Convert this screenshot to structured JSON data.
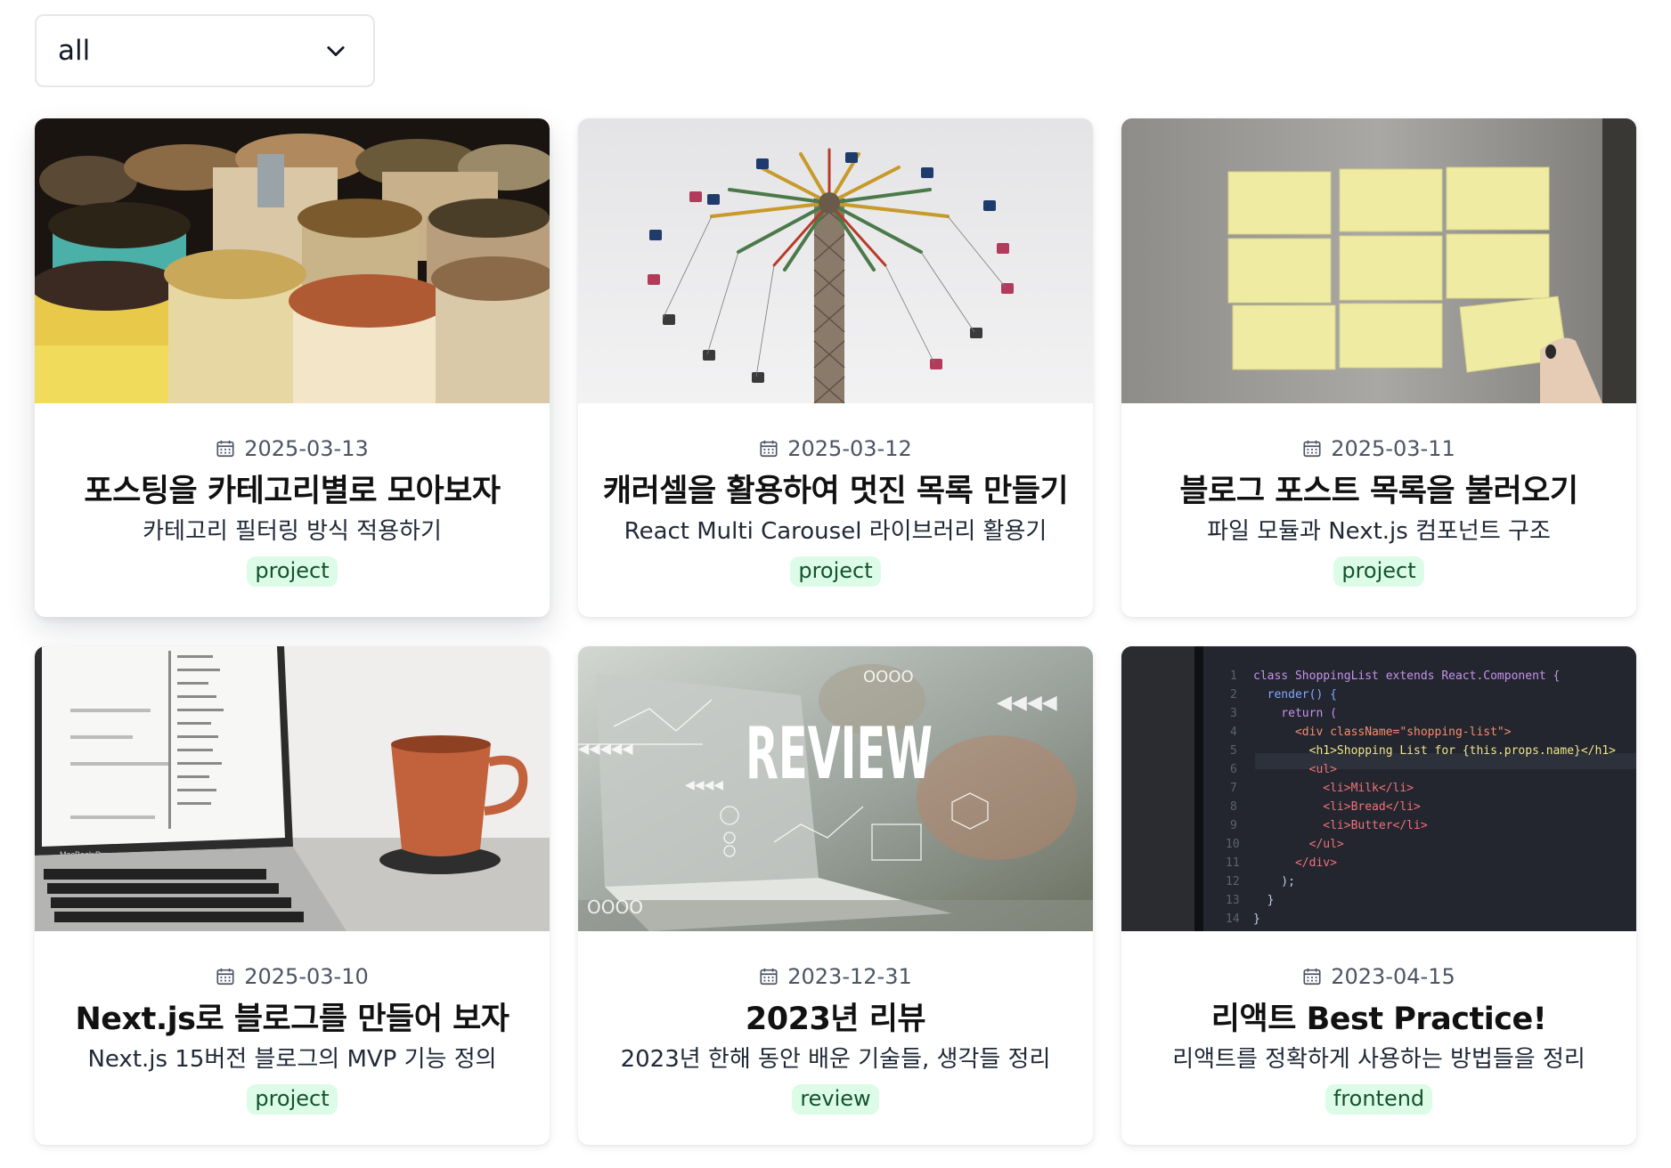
{
  "filter": {
    "selected": "all",
    "chevron_icon": "chevron-down-icon"
  },
  "colors": {
    "tag_background": "#dcfce7",
    "tag_text": "#14532d",
    "date_text": "#4b5563",
    "card_background": "#ffffff"
  },
  "posts": [
    {
      "date": "2025-03-13",
      "title": "포스팅을 카테고리별로 모아보자",
      "description": "카테고리 필터링 방식 적용하기",
      "tag": "project",
      "thumbnail": "spice-sacks-photo"
    },
    {
      "date": "2025-03-12",
      "title": "캐러셀을 활용하여 멋진 목록 만들기",
      "description": "React Multi Carousel 라이브러리 활용기",
      "tag": "project",
      "thumbnail": "swing-ride-photo"
    },
    {
      "date": "2025-03-11",
      "title": "블로그 포스트 목록을 불러오기",
      "description": "파일 모듈과 Next.js 컴포넌트 구조",
      "tag": "project",
      "thumbnail": "sticky-notes-photo"
    },
    {
      "date": "2025-03-10",
      "title": "Next.js로 블로그를 만들어 보자",
      "description": "Next.js 15버전 블로그의 MVP 기능 정의",
      "tag": "project",
      "thumbnail": "laptop-coffee-photo",
      "laptop_label": "MacBook Pro"
    },
    {
      "date": "2023-12-31",
      "title": "2023년 리뷰",
      "description": "2023년 한해 동안 배운 기술들, 생각들 정리",
      "tag": "review",
      "thumbnail": "review-hologram-photo",
      "overlay_text": "REVIEW"
    },
    {
      "date": "2023-04-15",
      "title": "리액트 Best Practice!",
      "description": "리액트를 정확하게 사용하는 방법들을 정리",
      "tag": "frontend",
      "thumbnail": "code-editor-photo",
      "code_lines": [
        "class ShoppingList extends React.Component {",
        "  render() {",
        "    return (",
        "      <div className=\"shopping-list\">",
        "        <h1>Shopping List for {this.props.name}</h1>",
        "        <ul>",
        "          <li>Milk</li>",
        "          <li>Bread</li>",
        "          <li>Butter</li>",
        "        </ul>",
        "      </div>",
        "    );",
        "  }",
        "}"
      ]
    }
  ]
}
